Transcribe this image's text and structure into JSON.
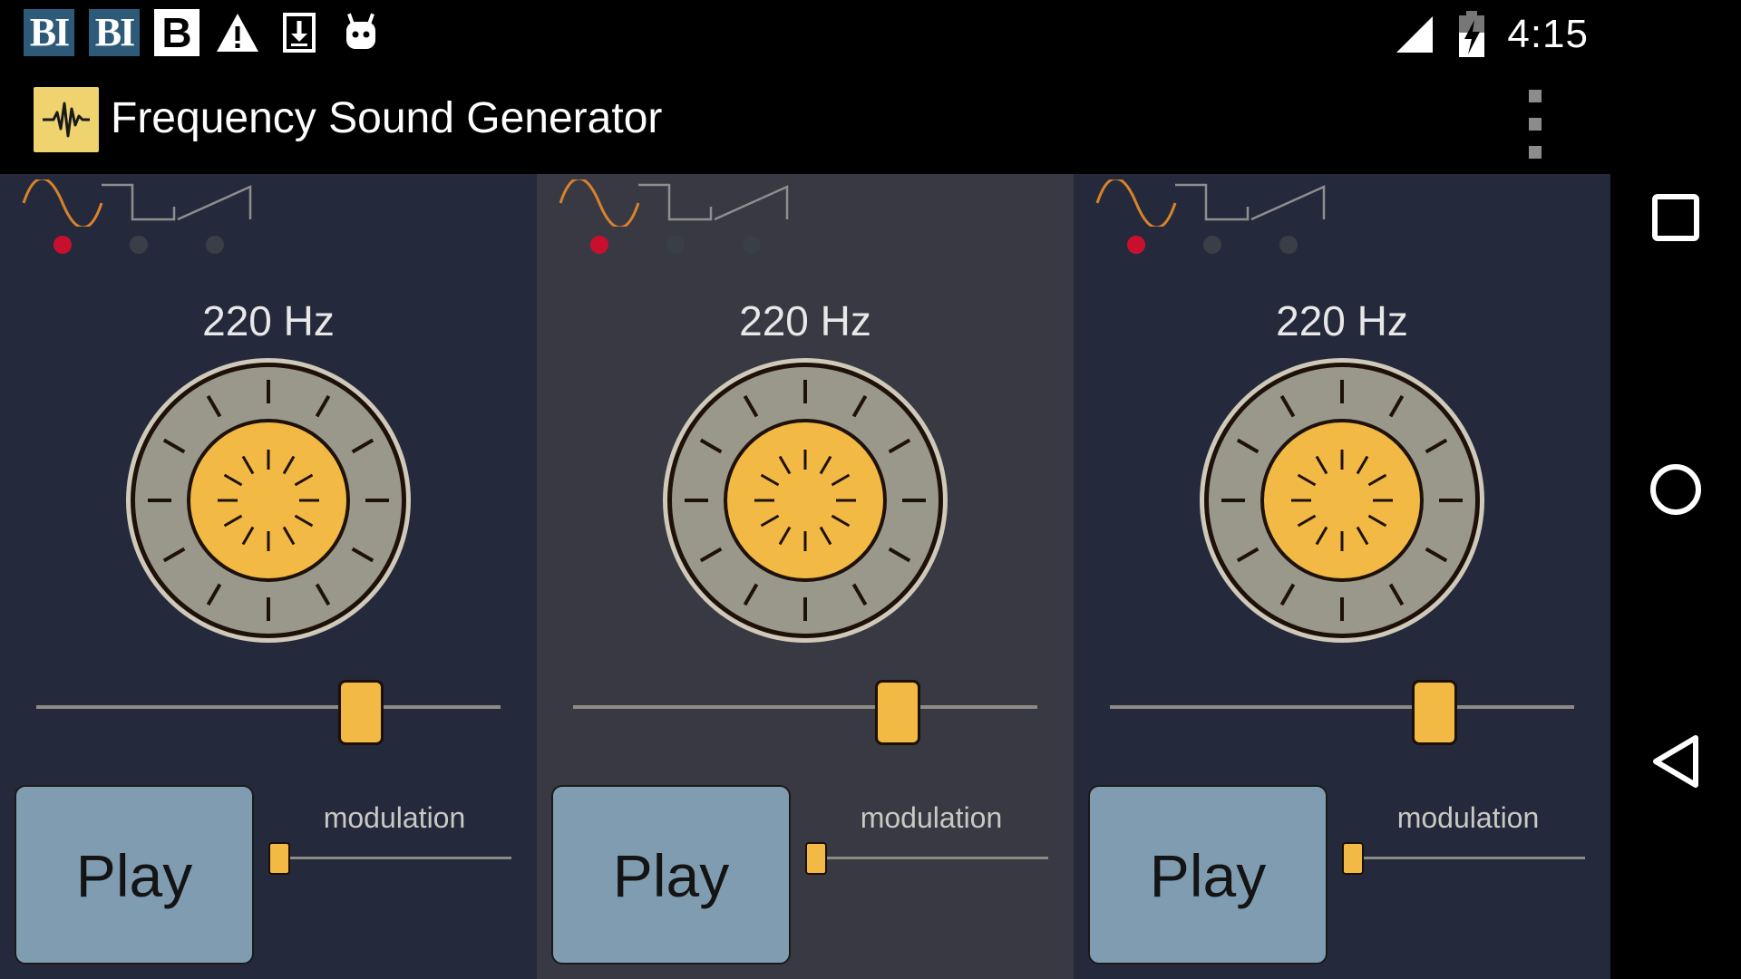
{
  "status_bar": {
    "notifications": [
      {
        "type": "text",
        "text": "BI",
        "icon": "bi-news-icon"
      },
      {
        "type": "text",
        "text": "BI",
        "icon": "bi-news-icon"
      },
      {
        "type": "text",
        "text": "B",
        "icon": "b-app-icon"
      },
      {
        "type": "icon",
        "icon": "warning-icon"
      },
      {
        "type": "icon",
        "icon": "download-icon"
      },
      {
        "type": "icon",
        "icon": "android-icon"
      }
    ],
    "clock": "4:15",
    "signal_icon": "cell-signal-icon",
    "battery_icon": "battery-charging-icon"
  },
  "app_bar": {
    "title": "Frequency Sound Generator",
    "app_icon": "sound-wave-icon",
    "overflow_icon": "overflow-menu-icon"
  },
  "colors": {
    "panel_dark": "#242a3b",
    "panel_active": "#383943",
    "accent": "#f2b944",
    "knob_ring": "#9a978b",
    "wave_active": "#d9822b",
    "wave_inactive": "#8e8e8e",
    "dot_active": "#c8102e",
    "play_button": "#7f9cb0"
  },
  "panels": [
    {
      "waveforms": [
        "sine-wave-icon",
        "square-wave-icon",
        "sawtooth-wave-icon"
      ],
      "selected_waveform": 0,
      "frequency_label": "220 Hz",
      "frequency_slider_fraction": 0.7,
      "play_label": "Play",
      "modulation_label": "modulation",
      "modulation_fraction": 0.0
    },
    {
      "waveforms": [
        "sine-wave-icon",
        "square-wave-icon",
        "sawtooth-wave-icon"
      ],
      "selected_waveform": 0,
      "frequency_label": "220 Hz",
      "frequency_slider_fraction": 0.7,
      "play_label": "Play",
      "modulation_label": "modulation",
      "modulation_fraction": 0.0
    },
    {
      "waveforms": [
        "sine-wave-icon",
        "square-wave-icon",
        "sawtooth-wave-icon"
      ],
      "selected_waveform": 0,
      "frequency_label": "220 Hz",
      "frequency_slider_fraction": 0.7,
      "play_label": "Play",
      "modulation_label": "modulation",
      "modulation_fraction": 0.0
    }
  ],
  "nav_bar": {
    "buttons": [
      "recents-icon",
      "home-icon",
      "back-icon"
    ]
  }
}
